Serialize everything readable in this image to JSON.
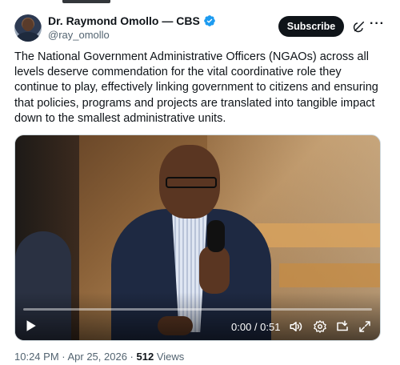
{
  "author": {
    "name": "Dr. Raymond Omollo — CBS",
    "handle": "@ray_omollo",
    "verified": true
  },
  "actions": {
    "subscribe_label": "Subscribe"
  },
  "tweet": {
    "text": "The National Government Administrative Officers (NGAOs) across all levels deserve commendation for the vital coordinative role they continue to play, effectively linking government to citizens and ensuring that policies, programs and projects are translated into tangible impact down to the smallest administrative units."
  },
  "video": {
    "time_readout": "0:00 / 0:51",
    "progress": 0
  },
  "meta": {
    "timestamp": "10:24 PM · Apr 25, 2026",
    "separator": " · ",
    "views_count": "512",
    "views_label": "Views"
  },
  "colors": {
    "accent": "#1d9bf0",
    "text": "#0f1419",
    "muted": "#536471"
  },
  "icons": [
    "verified-badge-icon",
    "grok-icon",
    "more-icon",
    "play-icon",
    "volume-icon",
    "settings-icon",
    "pip-icon",
    "fullscreen-icon"
  ]
}
